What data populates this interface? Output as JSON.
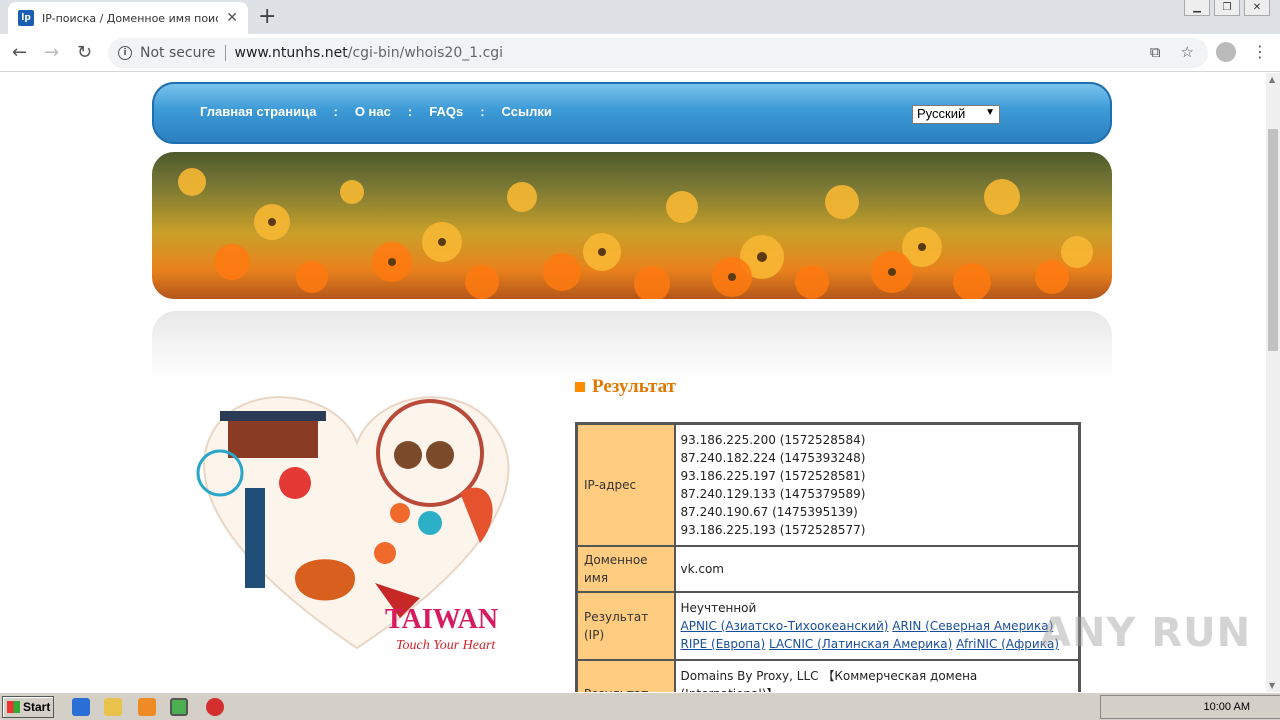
{
  "browser": {
    "tab_title": "IP-поиска / Доменное имя поиска /",
    "tab_favicon_text": "lp",
    "security_label": "Not secure",
    "url_host": "www.ntunhs.net",
    "url_path": "/cgi-bin/whois20_1.cgi"
  },
  "nav": {
    "links": [
      "Главная страница",
      "О нас",
      "FAQs",
      "Ссылки"
    ],
    "language": "Русский"
  },
  "logo": {
    "title": "TAIWAN",
    "tagline": "Touch Your Heart"
  },
  "result": {
    "heading": "Результат",
    "ip_label": "IP-адрес",
    "ip_addresses": [
      "93.186.225.200 (1572528584)",
      "87.240.182.224 (1475393248)",
      "93.186.225.197 (1572528581)",
      "87.240.129.133 (1475379589)",
      "87.240.190.67 (1475395139)",
      "93.186.225.193 (1572528577)"
    ],
    "domain_label": "Доменное имя",
    "domain_value": "vk.com",
    "ip_result_label": "Результат (IP)",
    "ip_result_status": "Неучтенной",
    "registries": [
      "APNIC (Азиатско-Тихоокеанский)",
      "ARIN (Северная Америка)",
      "RIPE (Европа)",
      "LACNIC (Латинская Америка)",
      "AfriNIC (Африка)"
    ],
    "domain_result_label": "Результат",
    "domain_result_value": "Domains By Proxy, LLC 【Коммерческая домена (International)】"
  },
  "watermark": "ANY RUN",
  "taskbar": {
    "start_label": "Start",
    "clock": "10:00 AM"
  },
  "colors": {
    "nav_blue": "#3c9ad6",
    "label_bg": "#ffcc80",
    "heading_orange": "#e07800",
    "link_blue": "#1a4e9a"
  }
}
